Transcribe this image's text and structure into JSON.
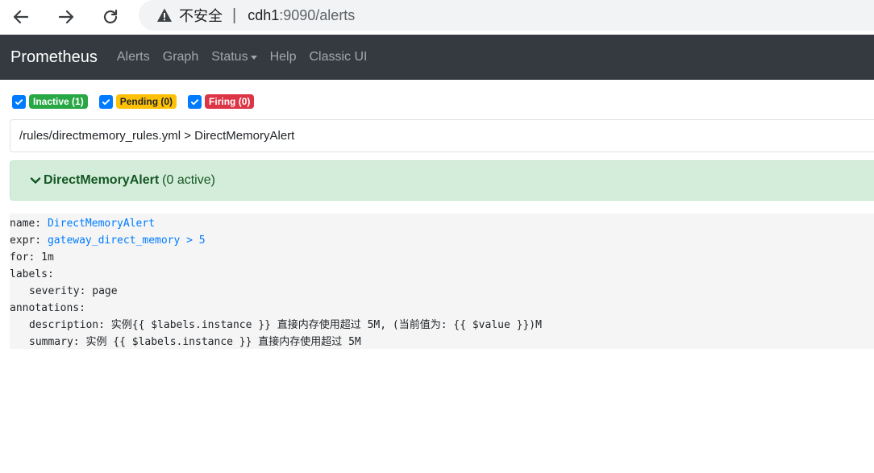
{
  "browser": {
    "security_label": "不安全",
    "separator": "|",
    "url_host": "cdh1",
    "url_rest": ":9090/alerts"
  },
  "navbar": {
    "brand": "Prometheus",
    "links": {
      "alerts": "Alerts",
      "graph": "Graph",
      "status": "Status",
      "help": "Help",
      "classic_ui": "Classic UI"
    }
  },
  "filters": {
    "inactive": "Inactive (1)",
    "pending": "Pending (0)",
    "firing": "Firing (0)"
  },
  "rule_group": {
    "path": "/rules/directmemory_rules.yml > DirectMemoryAlert"
  },
  "alert": {
    "name": "DirectMemoryAlert",
    "active": "(0 active)",
    "status_color": "#d4edda"
  },
  "rule": {
    "name_key": "name: ",
    "name_value": "DirectMemoryAlert",
    "expr_key": "expr: ",
    "expr_value": "gateway_direct_memory > 5",
    "for_line": "for: 1m",
    "labels_key": "labels:",
    "severity_line": "severity: page",
    "annotations_key": "annotations:",
    "description_line": "description: 实例{{ $labels.instance }} 直接内存使用超过 5M, (当前值为: {{ $value }})M",
    "summary_line": "summary: 实例 {{ $labels.instance }} 直接内存使用超过 5M"
  },
  "colors": {
    "navbar_bg": "#343a40",
    "primary": "#007bff",
    "success": "#28a745",
    "warning": "#ffc107",
    "danger": "#dc3545"
  },
  "icons": {
    "back": "arrow-left-icon",
    "forward": "arrow-right-icon",
    "reload": "reload-icon",
    "warning": "warning-triangle-icon",
    "check": "check-icon",
    "chevron": "chevron-down-icon"
  }
}
